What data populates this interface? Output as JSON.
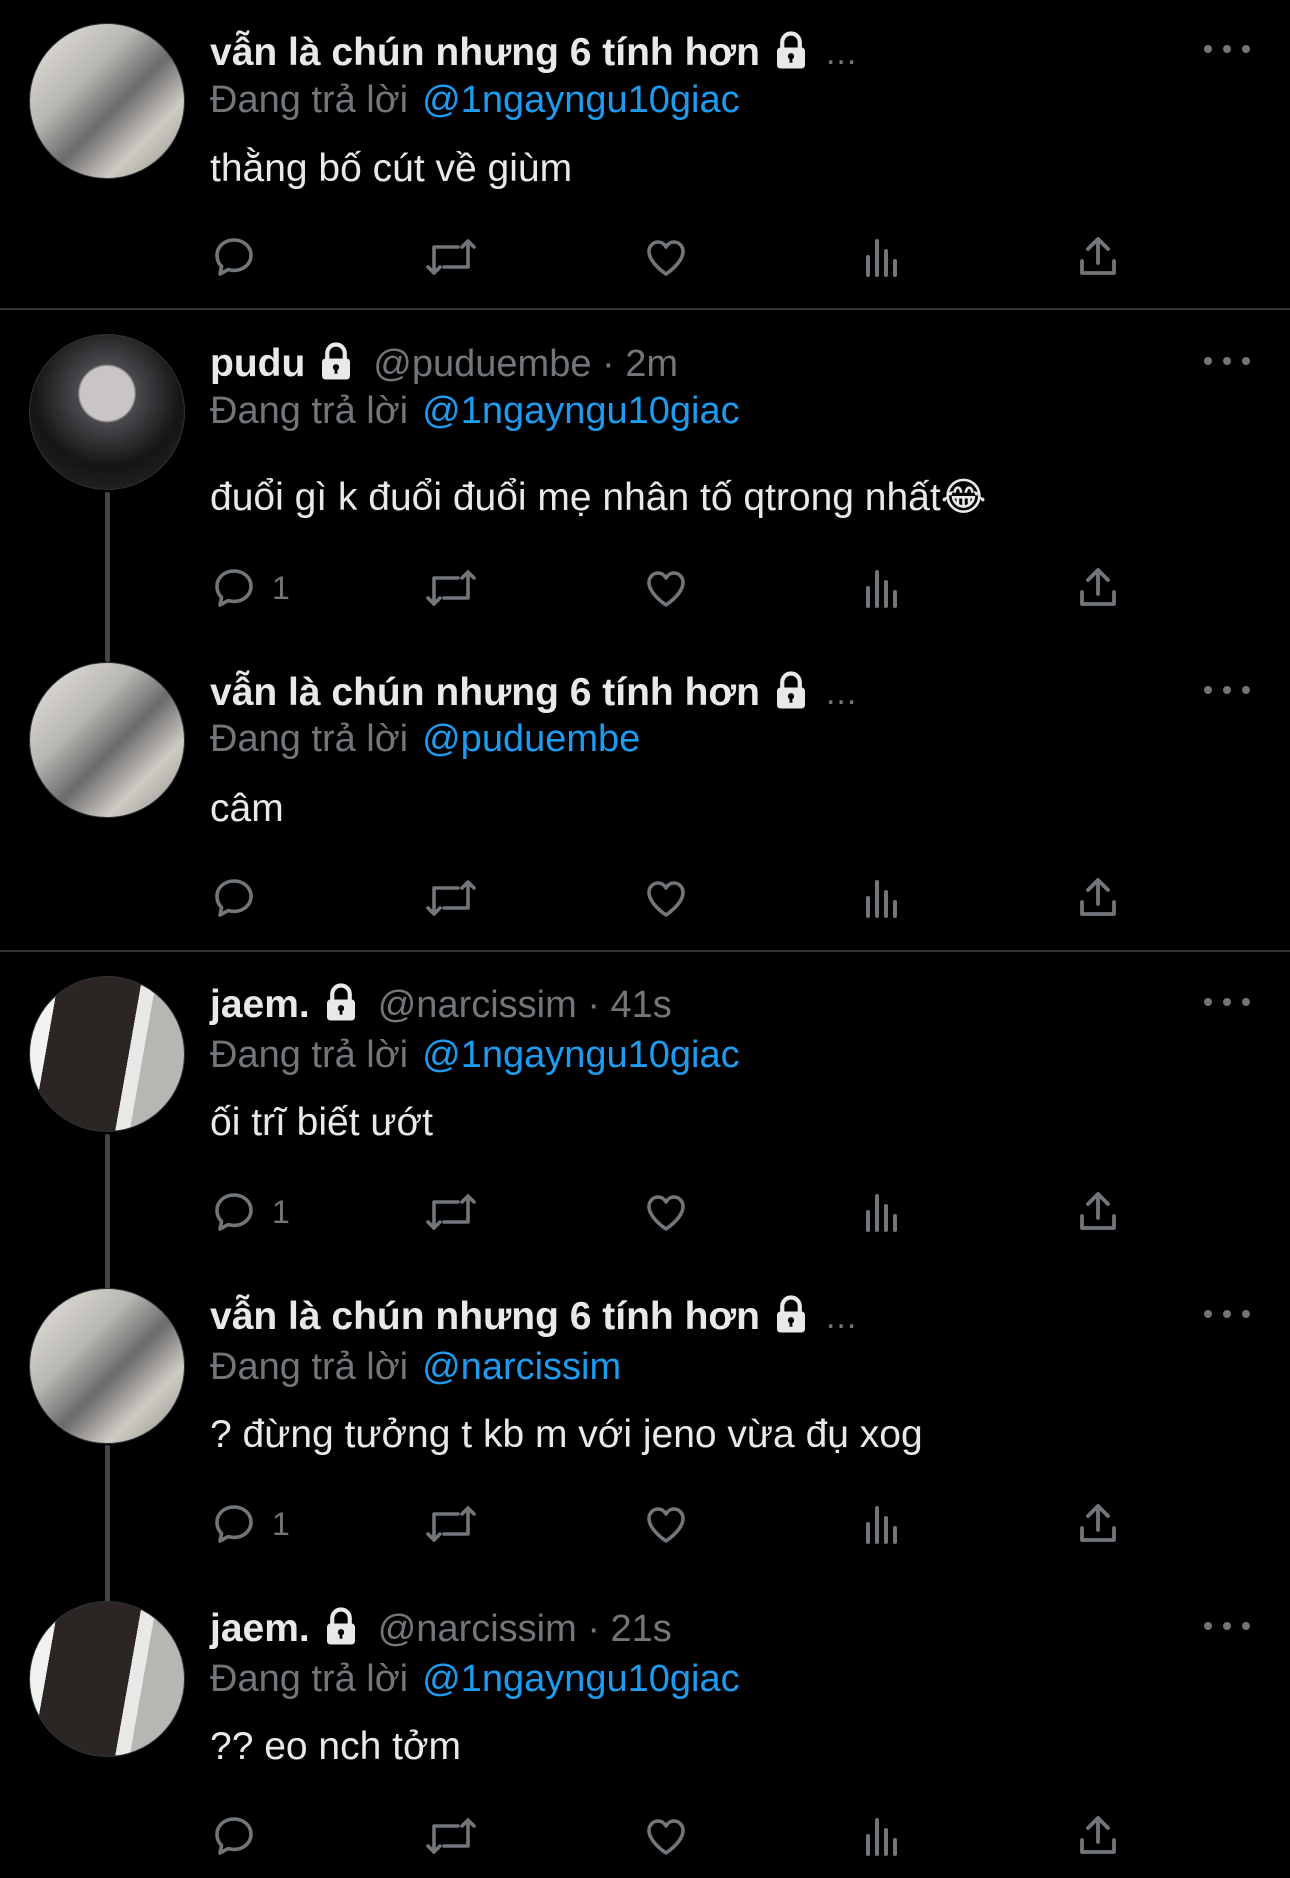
{
  "tweets": [
    {
      "display_name": "vẫn là chún nhưng 6 tính hơn",
      "handle_time": "",
      "truncated": "...",
      "reply_label": "Đang trả lời",
      "reply_to": "@1ngayngu10giac",
      "text": "thằng bố cút về giùm",
      "reply_count": ""
    },
    {
      "display_name": "pudu",
      "handle_time": "@puduembe · 2m",
      "truncated": "",
      "reply_label": "Đang trả lời",
      "reply_to": "@1ngayngu10giac",
      "text": "đuổi gì k đuổi đuổi mẹ nhân tố qtrong nhất😂",
      "reply_count": "1"
    },
    {
      "display_name": "vẫn là chún nhưng 6 tính hơn",
      "handle_time": "",
      "truncated": "...",
      "reply_label": "Đang trả lời",
      "reply_to": "@puduembe",
      "text": "câm",
      "reply_count": ""
    },
    {
      "display_name": "jaem.",
      "handle_time": "@narcissim · 41s",
      "truncated": "",
      "reply_label": "Đang trả lời",
      "reply_to": "@1ngayngu10giac",
      "text": "ối trĩ biết ướt",
      "reply_count": "1"
    },
    {
      "display_name": "vẫn là chún nhưng 6 tính hơn",
      "handle_time": "",
      "truncated": "...",
      "reply_label": "Đang trả lời",
      "reply_to": "@narcissim",
      "text": "? đừng tưởng t kb m với jeno vừa đụ xog",
      "reply_count": "1"
    },
    {
      "display_name": "jaem.",
      "handle_time": "@narcissim · 21s",
      "truncated": "",
      "reply_label": "Đang trả lời",
      "reply_to": "@1ngayngu10giac",
      "text": "?? eo nch tởm",
      "reply_count": ""
    }
  ],
  "icons": {
    "reply": "reply-icon",
    "retweet": "retweet-icon",
    "like": "heart-icon",
    "views": "analytics-icon",
    "share": "share-icon",
    "more": "more-icon",
    "protected": "lock-icon"
  },
  "colors": {
    "background": "#000000",
    "text": "#e7e9ea",
    "secondary": "#71767b",
    "mention": "#1d9bf0",
    "divider": "#2f3336"
  }
}
